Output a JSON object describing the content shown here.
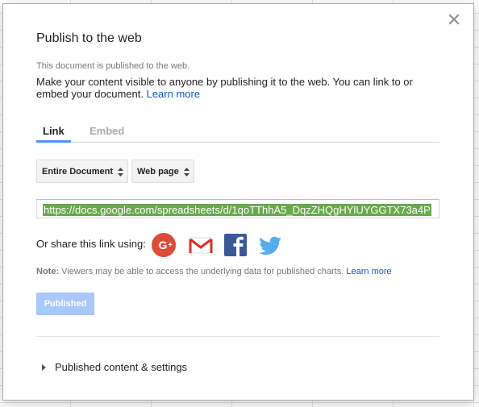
{
  "dialog": {
    "title": "Publish to the web",
    "status": "This document is published to the web.",
    "description": "Make your content visible to anyone by publishing it to the web. You can link to or embed your document.",
    "learn_more": "Learn more",
    "close_icon": "close-icon"
  },
  "tabs": [
    {
      "label": "Link",
      "active": true
    },
    {
      "label": "Embed",
      "active": false
    }
  ],
  "selects": {
    "scope": "Entire Document",
    "format": "Web page"
  },
  "url": "https://docs.google.com/spreadsheets/d/1qoTThhA5_DqzZHQgHYlUYGGTX73a4P",
  "share": {
    "label": "Or share this link using:",
    "icons": [
      "google-plus-icon",
      "gmail-icon",
      "facebook-icon",
      "twitter-icon"
    ]
  },
  "note": {
    "prefix": "Note:",
    "text": "Viewers may be able to access the underlying data for published charts.",
    "learn_more": "Learn more"
  },
  "published_button": "Published",
  "settings_toggle": "Published content & settings",
  "colors": {
    "accent_blue": "#4d90fe",
    "link": "#1155cc",
    "url_highlight": "#6aa84f",
    "published_disabled": "#a9c8fb",
    "gplus_red": "#dd4b39",
    "facebook_blue": "#3b5998",
    "twitter_blue": "#55acee"
  }
}
